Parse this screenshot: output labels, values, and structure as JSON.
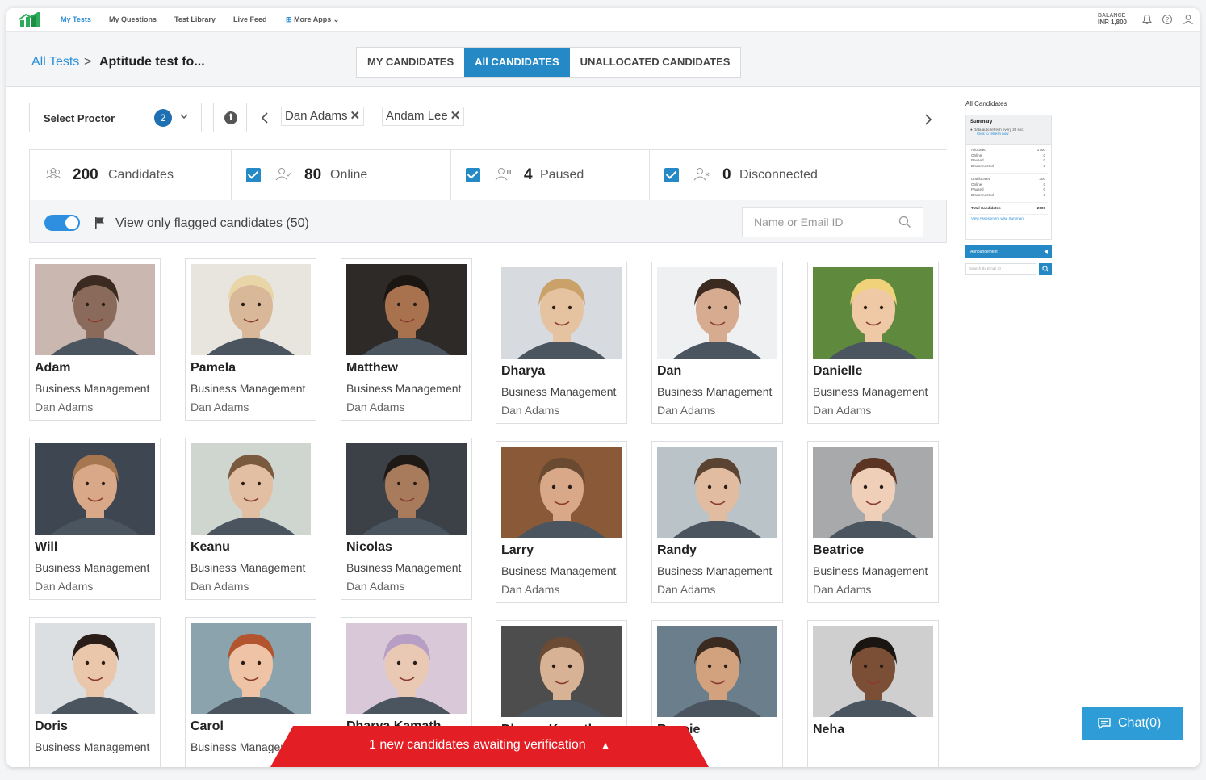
{
  "nav": {
    "items": [
      "My Tests",
      "My Questions",
      "Test Library",
      "Live Feed",
      "More Apps"
    ],
    "balance_label": "BALANCE",
    "balance_value": "INR 1,800"
  },
  "header": {
    "breadcrumb_link": "All Tests",
    "breadcrumb_sep": ">",
    "title": "Aptitude test fo...",
    "tabs": [
      "MY CANDIDATES",
      "All CANDIDATES",
      "UNALLOCATED CANDIDATES"
    ],
    "active_tab": "All CANDIDATES"
  },
  "filters": {
    "proctor_label": "Select Proctor",
    "proctor_count": "2",
    "chips": [
      "Dan Adams",
      "Andam Lee"
    ]
  },
  "stats": {
    "candidates_num": "200",
    "candidates_label": "Candidates",
    "online_num": "80",
    "online_label": "Online",
    "paused_num": "4",
    "paused_label": "Paused",
    "disconnected_num": "0",
    "disconnected_label": "Disconnected",
    "flag_label": "View only flagged candidates (50)",
    "search_placeholder": "Name or Email ID"
  },
  "candidates": [
    {
      "name": "Adam",
      "dept": "Business Management",
      "proctor": "Dan Adams"
    },
    {
      "name": "Pamela",
      "dept": "Business Management",
      "proctor": "Dan Adams"
    },
    {
      "name": "Matthew",
      "dept": "Business Management",
      "proctor": "Dan Adams"
    },
    {
      "name": "Dharya",
      "dept": "Business Management",
      "proctor": "Dan Adams"
    },
    {
      "name": "Dan",
      "dept": "Business Management",
      "proctor": "Dan Adams"
    },
    {
      "name": "Danielle",
      "dept": "Business Management",
      "proctor": "Dan Adams"
    },
    {
      "name": "Will",
      "dept": "Business Management",
      "proctor": "Dan Adams"
    },
    {
      "name": "Keanu",
      "dept": "Business Management",
      "proctor": "Dan Adams"
    },
    {
      "name": "Nicolas",
      "dept": "Business Management",
      "proctor": "Dan Adams"
    },
    {
      "name": "Larry",
      "dept": "Business Management",
      "proctor": "Dan Adams"
    },
    {
      "name": "Randy",
      "dept": "Business Management",
      "proctor": "Dan Adams"
    },
    {
      "name": "Beatrice",
      "dept": "Business Management",
      "proctor": "Dan Adams"
    },
    {
      "name": "Doris",
      "dept": "Business Management",
      "proctor": ""
    },
    {
      "name": "Carol",
      "dept": "Business Managem",
      "proctor": ""
    },
    {
      "name": "Dharya Kamath",
      "dept": "",
      "proctor": ""
    },
    {
      "name": "Dharya Kamath",
      "dept": "",
      "proctor": ""
    },
    {
      "name": "Rennie",
      "dept": "",
      "proctor": ""
    },
    {
      "name": "Neha",
      "dept": "",
      "proctor": ""
    }
  ],
  "summary_panel": {
    "title": "All Candidates",
    "heading": "Summary",
    "note": "Data auto refresh every 30 sec.",
    "refresh_link": "Click to refresh now",
    "allocated": [
      [
        "Allocated",
        "1700"
      ],
      [
        "Online",
        "0"
      ],
      [
        "Paused",
        "0"
      ],
      [
        "Disconnected",
        "0"
      ]
    ],
    "unallocated": [
      [
        "Unallocated",
        "300"
      ],
      [
        "Online",
        "0"
      ],
      [
        "Paused",
        "0"
      ],
      [
        "Disconnected",
        "0"
      ]
    ],
    "total": [
      "Total Candidates",
      "2000"
    ],
    "link": "View Assessment wise Summary",
    "announcement": "Announcement",
    "search_placeholder": "Search By Email ID"
  },
  "banner": "1 new candidates awaiting verification",
  "chat": "Chat(0)",
  "colors": {
    "accent": "#2489c5",
    "banner": "#e31e24",
    "chat": "#2d9cd7"
  }
}
